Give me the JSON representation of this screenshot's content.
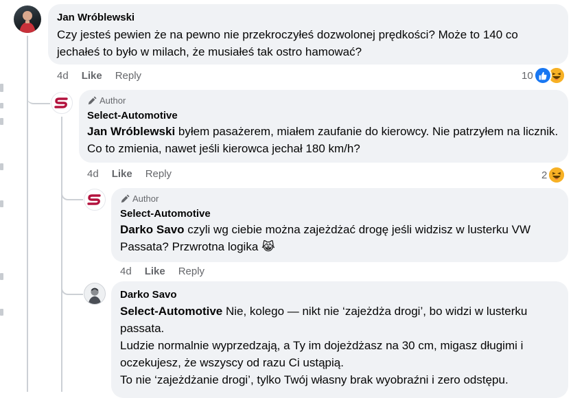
{
  "comments": [
    {
      "author": "Jan Wróblewski",
      "body": "Czy jesteś pewien że na pewno nie przekroczyłeś dozwolonej prędkości? Może to 140 co jechałeś to było w milach, że musiałeś tak ostro hamować?",
      "time": "4d",
      "like": "Like",
      "reply": "Reply",
      "reaction_count": "10"
    },
    {
      "badge": "Author",
      "author": "Select-Automotive",
      "mention": "Jan Wróblewski",
      "body": " byłem pasażerem, miałem zaufanie do kierowcy. Nie patrzyłem na licznik. Co to zmienia, nawet jeśli kierowca jechał 180 km/h?",
      "time": "4d",
      "like": "Like",
      "reply": "Reply",
      "reaction_count": "2"
    },
    {
      "badge": "Author",
      "author": "Select-Automotive",
      "mention": "Darko Savo",
      "body": " czyli wg ciebie można zajeżdżać drogę jeśli widzisz w lusterku VW Passata? Przwrotna logika",
      "emoji": "😹",
      "time": "4d",
      "like": "Like",
      "reply": "Reply"
    },
    {
      "author": "Darko Savo",
      "mention": "Select-Automotive",
      "line1": " Nie, kolego — nikt nie ‘zajeżdża drogi’, bo widzi w lusterku passata.",
      "line2": "Ludzie normalnie wyprzedzają, a Ty im dojeżdżasz na 30 cm, migasz długimi i oczekujesz, że wszyscy od razu Ci ustąpią.",
      "line3": "To nie ‘zajeżdżanie drogi’, tylko Twój własny brak wyobraźni i zero odstępu."
    }
  ],
  "colors": {
    "like_blue": "#1877f2",
    "haha_yellow": "#f7b125",
    "brand_red": "#b3123d"
  }
}
